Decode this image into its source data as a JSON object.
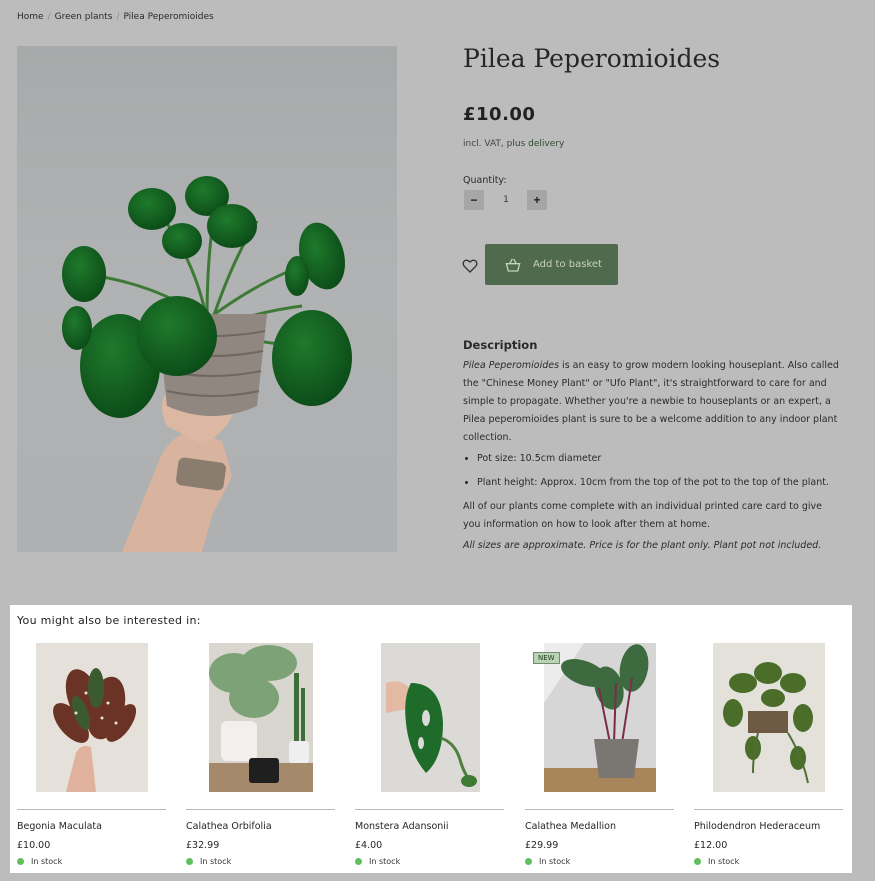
{
  "breadcrumb": {
    "home": "Home",
    "category": "Green plants",
    "current": "Pilea Peperomioides"
  },
  "product": {
    "title": "Pilea Peperomioides",
    "price": "£10.00",
    "vat_prefix": "incl. VAT,",
    "delivery_link": "plus delivery",
    "quantity_label": "Quantity:",
    "quantity_value": "1",
    "minus_label": "−",
    "plus_label": "+",
    "wishlist_icon": "heart-icon",
    "basket_icon": "basket-icon",
    "basket_label": "Add to basket",
    "description_heading": "Description",
    "description_name": "Pilea Peperomioides",
    "description_text": " is an easy to grow modern looking houseplant. Also called the \"Chinese Money Plant\" or \"Ufo Plant\", it's straightforward to care for and simple to propagate. Whether you're a newbie to houseplants or an expert, a Pilea peperomioides plant is sure to be a welcome addition to any indoor plant collection.",
    "bullets": [
      "Pot size: 10.5cm diameter",
      "Plant height: Approx. 10cm from the top of the pot to the top of the plant."
    ],
    "care_text": "All of our plants come complete with an individual printed care card to give you information on how to look after them at home.",
    "note": "All sizes are approximate. Price is for the plant only. Plant pot not included."
  },
  "related": {
    "title": "You might also be interested in:",
    "items": [
      {
        "name": "Begonia Maculata",
        "price": "£10.00",
        "stock": "In stock",
        "badge": ""
      },
      {
        "name": "Calathea Orbifolia",
        "price": "£32.99",
        "stock": "In stock",
        "badge": ""
      },
      {
        "name": "Monstera Adansonii",
        "price": "£4.00",
        "stock": "In stock",
        "badge": ""
      },
      {
        "name": "Calathea Medallion",
        "price": "£29.99",
        "stock": "In stock",
        "badge": "NEW"
      },
      {
        "name": "Philodendron Hederaceum",
        "price": "£12.00",
        "stock": "In stock",
        "badge": ""
      }
    ]
  },
  "colors": {
    "overlay_bg": "#bcbcbc",
    "brand_green": "#4f6a4c",
    "in_stock": "#5fbf5f",
    "link_green": "#2f4d2f"
  }
}
